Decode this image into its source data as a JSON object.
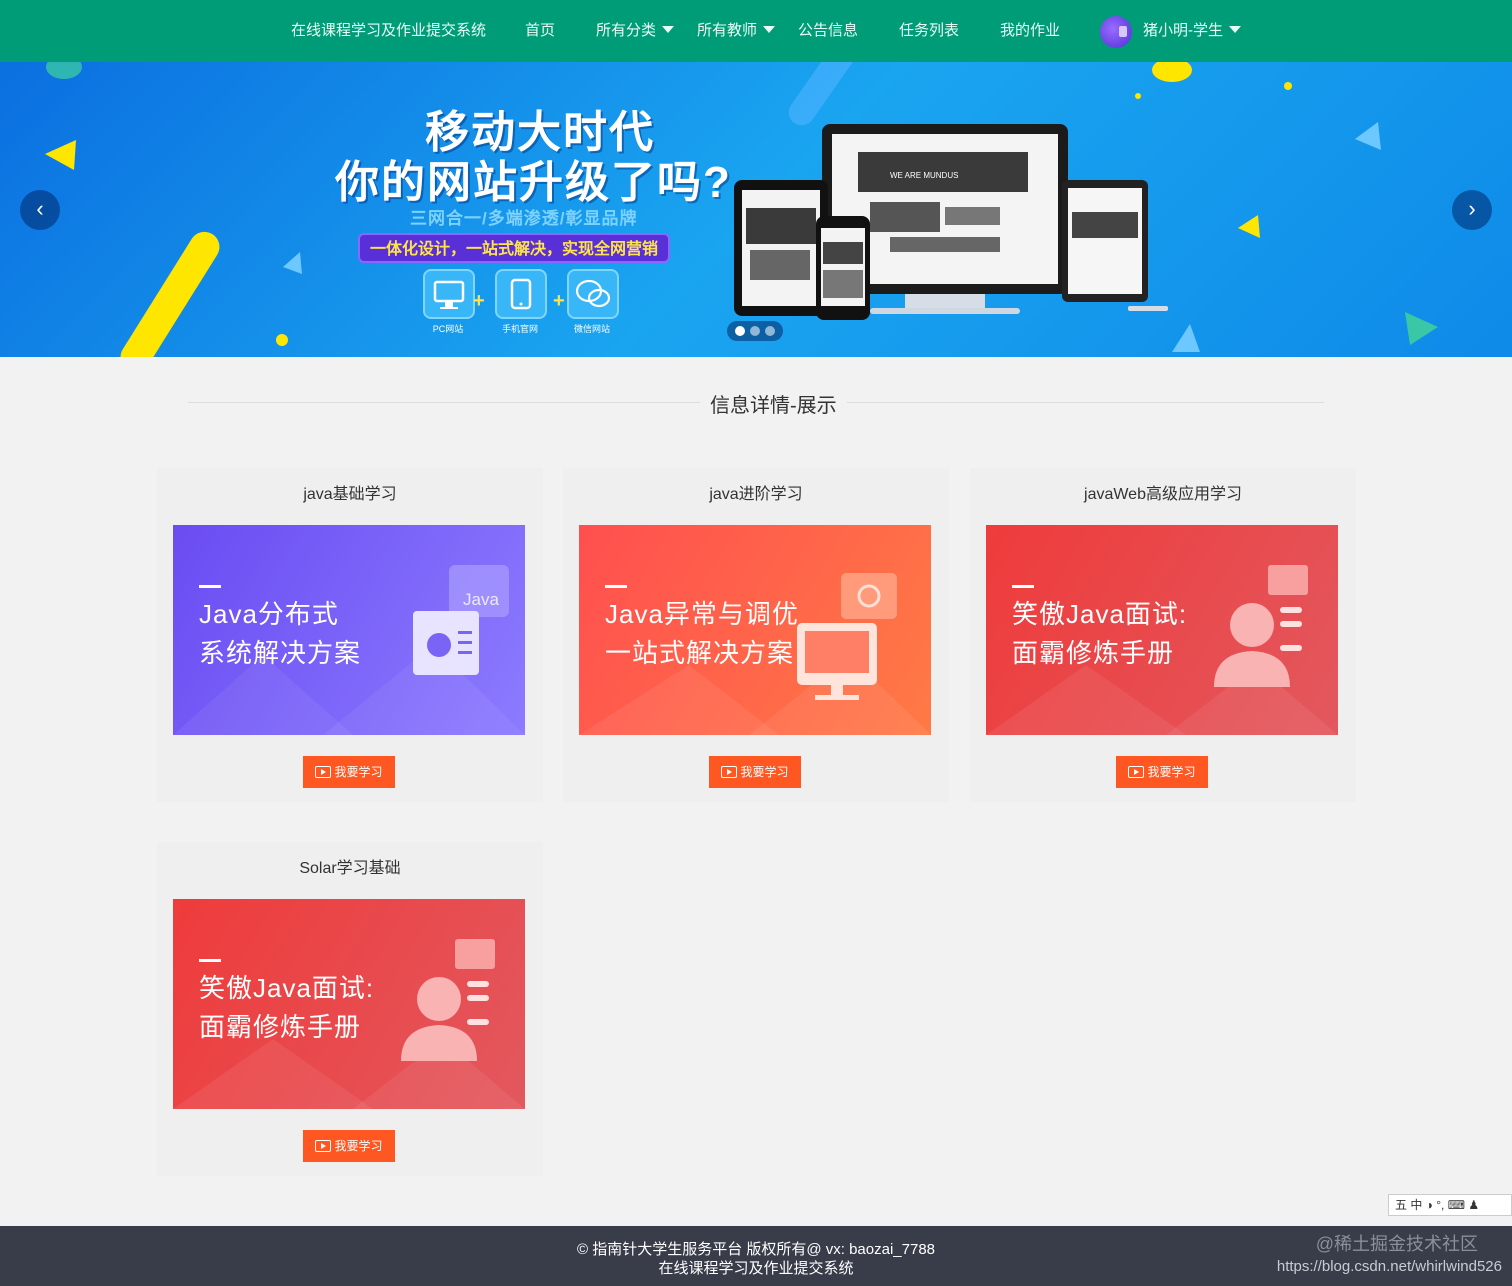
{
  "nav": {
    "brand": "在线课程学习及作业提交系统",
    "home": "首页",
    "categories": "所有分类",
    "teachers": "所有教师",
    "notices": "公告信息",
    "tasks": "任务列表",
    "homework": "我的作业",
    "user": "猪小明-学生"
  },
  "banner": {
    "line1": "移动大时代",
    "line2": "你的网站升级了吗?",
    "line3": "三网合一/多端渗透/彰显品牌",
    "line4": "一体化设计，一站式解决，实现全网营销",
    "devices": [
      "PC网站",
      "手机官网",
      "微信网站"
    ],
    "mockup_text": "WE ARE MUNDUS",
    "prev_glyph": "‹",
    "next_glyph": "›",
    "active_slide": 0,
    "slide_count": 3
  },
  "section": {
    "title": "信息详情-展示"
  },
  "courses": [
    {
      "title": "java基础学习",
      "image_text": [
        "Java分布式",
        "系统解决方案"
      ],
      "image_tag": "Java",
      "button": "我要学习"
    },
    {
      "title": "java进阶学习",
      "image_text": [
        "Java异常与调优",
        "一站式解决方案"
      ],
      "button": "我要学习"
    },
    {
      "title": "javaWeb高级应用学习",
      "image_text": [
        "笑傲Java面试:",
        "面霸修炼手册"
      ],
      "button": "我要学习"
    },
    {
      "title": "Solar学习基础",
      "image_text": [
        "笑傲Java面试:",
        "面霸修炼手册"
      ],
      "button": "我要学习"
    }
  ],
  "footer": {
    "line1": "© 指南针大学生服务平台 版权所有@ vx: baozai_7788",
    "line2": "在线课程学习及作业提交系统"
  },
  "watermark": {
    "line1": "@稀土掘金技术社区",
    "line2": "https://blog.csdn.net/whirlwind526"
  },
  "ime": "五 中 ◑ °, ⌨ ♟",
  "colors": {
    "nav_bg": "#009b77",
    "button": "#ff5722",
    "footer_bg": "#393d49"
  }
}
